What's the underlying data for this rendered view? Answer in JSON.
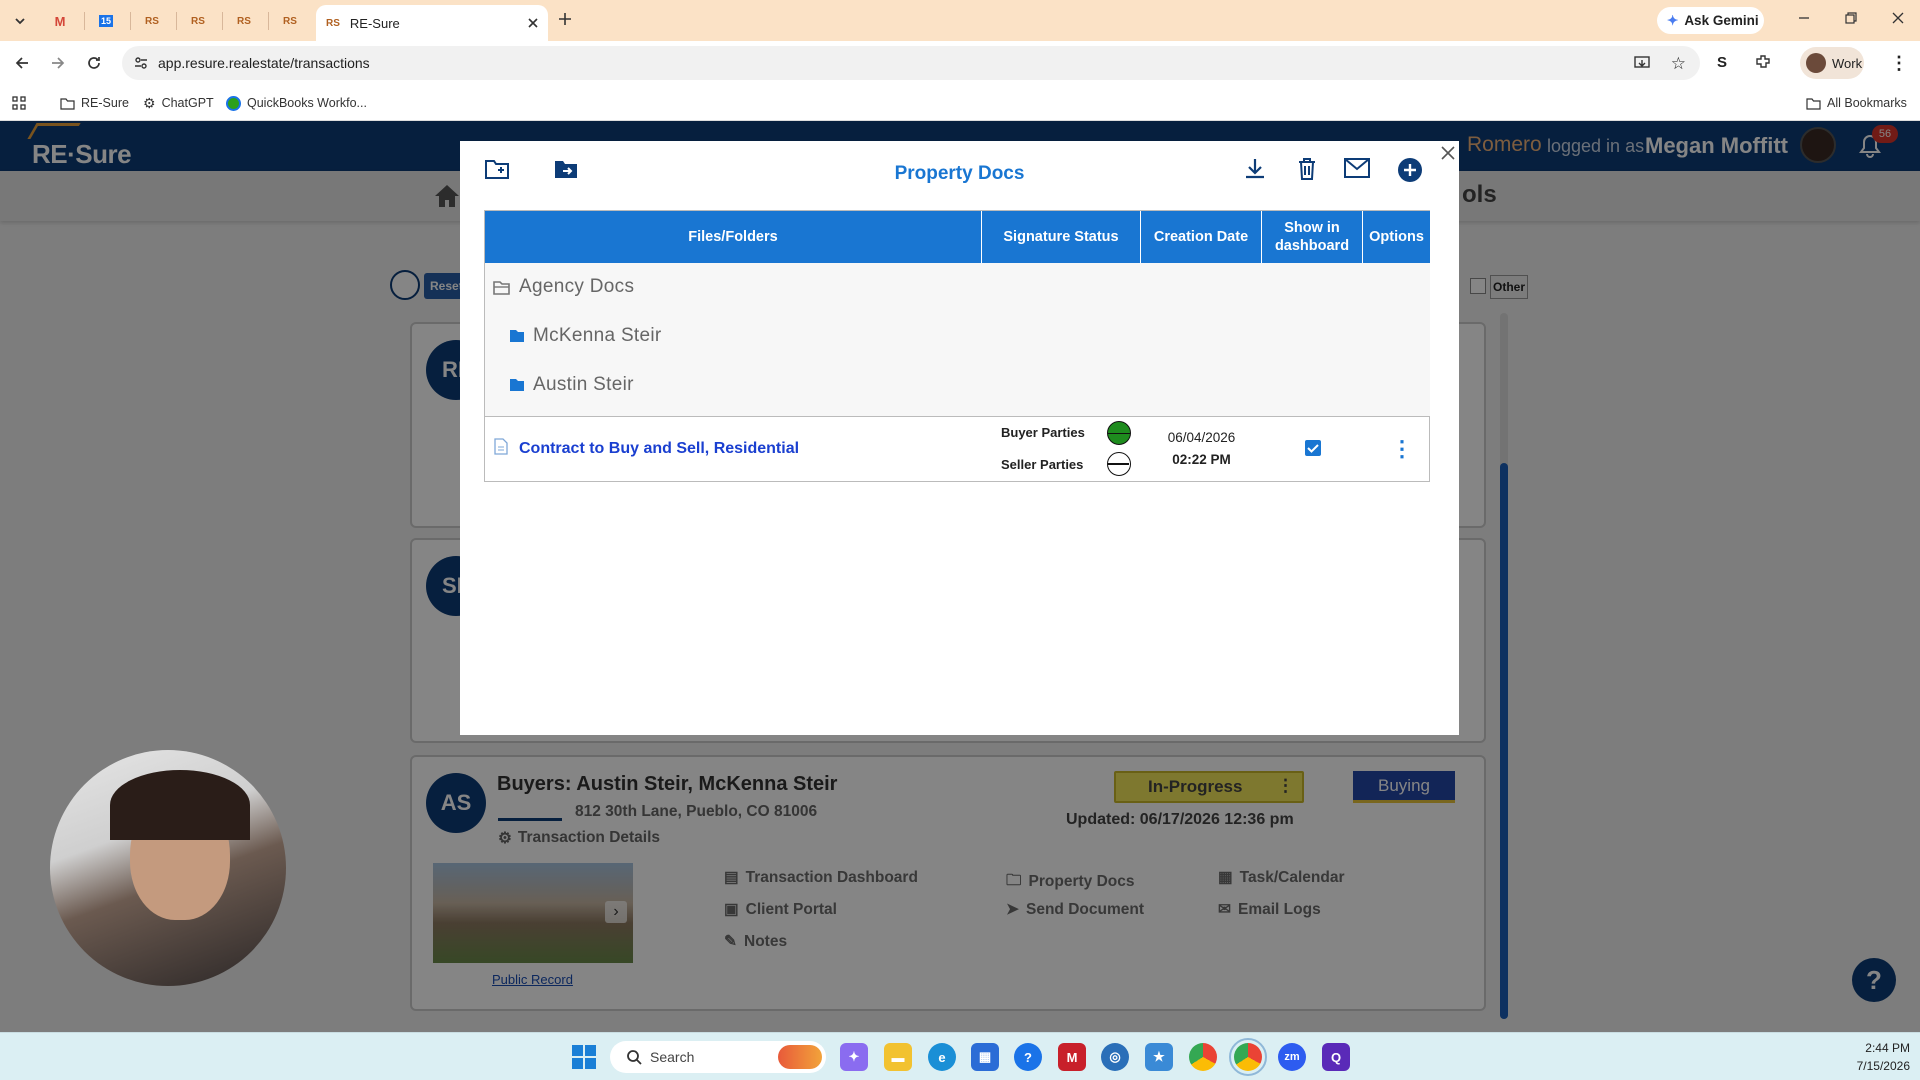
{
  "browser": {
    "tabs": [
      {
        "label": "M",
        "color": "#d44638"
      },
      {
        "label": "15",
        "color": "#1a73e8"
      },
      {
        "label": "RS",
        "color": "#b06020"
      },
      {
        "label": "RS",
        "color": "#b06020"
      },
      {
        "label": "RS",
        "color": "#b06020"
      },
      {
        "label": "RS",
        "color": "#b06020"
      }
    ],
    "active_tab": {
      "favicon": "RS",
      "title": "RE-Sure"
    },
    "url": "app.resure.realestate/transactions",
    "ask_gemini": "Ask Gemini",
    "profile": "Work",
    "bookmarks": [
      "RE-Sure",
      "ChatGPT",
      "QuickBooks Workfo..."
    ],
    "all_bookmarks": "All Bookmarks"
  },
  "app": {
    "logo": "RE·Sure",
    "login_name_partial": "Romero",
    "logged_in_as": "logged in as",
    "user_name": "Megan Moffitt",
    "notification_count": "56",
    "nav_partial": "ols",
    "reset_label": "Reset",
    "other_label": "Other",
    "card_initials": [
      "RE",
      "SE"
    ],
    "transaction": {
      "initials": "AS",
      "buyers": "Buyers: Austin Steir, McKenna Steir",
      "address": "812 30th Lane, Pueblo, CO 81006",
      "details_link": "Transaction Details",
      "status": "In-Progress",
      "updated": "Updated: 06/17/2026 12:36 pm",
      "side": "Buying",
      "public_record": "Public Record",
      "links": [
        {
          "icon": "dashboard-icon",
          "label": "Transaction Dashboard"
        },
        {
          "icon": "folder-icon",
          "label": "Property Docs"
        },
        {
          "icon": "calendar-icon",
          "label": "Task/Calendar"
        },
        {
          "icon": "client-icon",
          "label": "Client Portal"
        },
        {
          "icon": "send-icon",
          "label": "Send Document"
        },
        {
          "icon": "email-log-icon",
          "label": "Email Logs"
        },
        {
          "icon": "notes-icon",
          "label": "Notes"
        }
      ]
    }
  },
  "modal": {
    "title": "Property Docs",
    "columns": [
      "Files/Folders",
      "Signature Status",
      "Creation Date",
      "Show in dashboard",
      "Options"
    ],
    "root_folder": "Agency Docs",
    "subfolders": [
      "McKenna Steir",
      "Austin Steir"
    ],
    "document": {
      "name": "Contract to Buy and Sell, Residential",
      "parties": [
        {
          "label": "Buyer Parties",
          "status": "signed",
          "color": "#1e8c1e"
        },
        {
          "label": "Seller Parties",
          "status": "pending"
        }
      ],
      "date": "06/04/2026",
      "time": "02:22 PM",
      "show_in_dashboard": true
    }
  },
  "taskbar": {
    "search_placeholder": "Search",
    "time": "2:44 PM",
    "date": "7/15/2026"
  },
  "colors": {
    "brand": "#0d3c77",
    "accent": "#1976d2",
    "status_yellow": "#f2e65a"
  }
}
